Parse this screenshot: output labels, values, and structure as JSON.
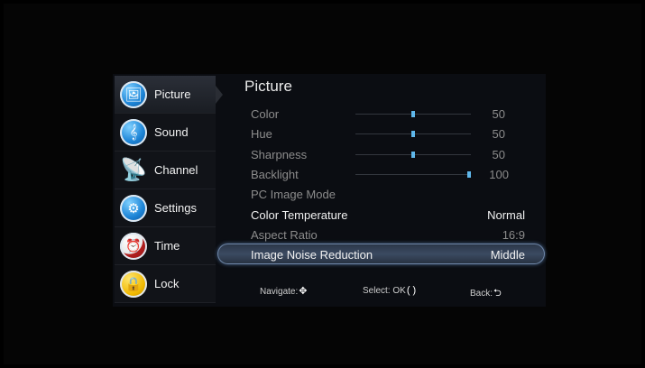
{
  "sidebar": {
    "items": [
      {
        "label": "Picture",
        "icon": "picture-icon"
      },
      {
        "label": "Sound",
        "icon": "music-note-icon"
      },
      {
        "label": "Channel",
        "icon": "satellite-dish-icon"
      },
      {
        "label": "Settings",
        "icon": "gear-icon"
      },
      {
        "label": "Time",
        "icon": "alarm-clock-icon"
      },
      {
        "label": "Lock",
        "icon": "padlock-icon"
      }
    ],
    "active_index": 0
  },
  "panel": {
    "title": "Picture",
    "rows": [
      {
        "label": "Color",
        "value": "50",
        "slider": 0.5
      },
      {
        "label": "Hue",
        "value": "50",
        "slider": 0.5
      },
      {
        "label": "Sharpness",
        "value": "50",
        "slider": 0.5
      },
      {
        "label": "Backlight",
        "value": "100",
        "slider": 1.0
      },
      {
        "label": "PC Image Mode",
        "value": ""
      },
      {
        "label": "Color Temperature",
        "value": "Normal"
      },
      {
        "label": "Aspect Ratio",
        "value": "16:9"
      },
      {
        "label": "Image Noise Reduction",
        "value": "Middle",
        "selected": true
      }
    ]
  },
  "footer": {
    "navigate": "Navigate:",
    "select": "Select: OK",
    "back": "Back:"
  },
  "colors": {
    "slider_knob": "#5fb7ea",
    "highlight": "#3b4a61"
  }
}
